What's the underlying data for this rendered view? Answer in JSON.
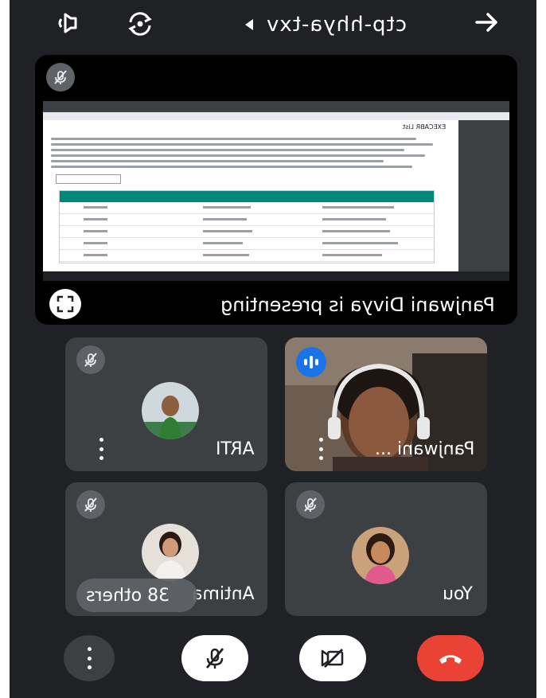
{
  "topbar": {
    "meeting_code": "ctp-hhya-txv",
    "icons": [
      "speaker-icon",
      "switch-camera-icon",
      "arrow-icon"
    ]
  },
  "presentation": {
    "presenter_text": "Panjwani Divya is presenting",
    "shared_screen": {
      "page_heading": "EXECABR List"
    }
  },
  "participants": [
    {
      "name": "Panjwani ...",
      "muted": false,
      "speaking": true
    },
    {
      "name": "ARTI",
      "muted": true
    },
    {
      "name": "You",
      "muted": true
    },
    {
      "name": "Antima",
      "muted": true
    }
  ],
  "others_label": "38 others",
  "controls": [
    "more-options",
    "microphone-off",
    "camera-off",
    "end-call"
  ],
  "colors": {
    "background": "#202124",
    "tile": "#3c4043",
    "end_call": "#ea4335",
    "speaking": "#1a73e8"
  }
}
